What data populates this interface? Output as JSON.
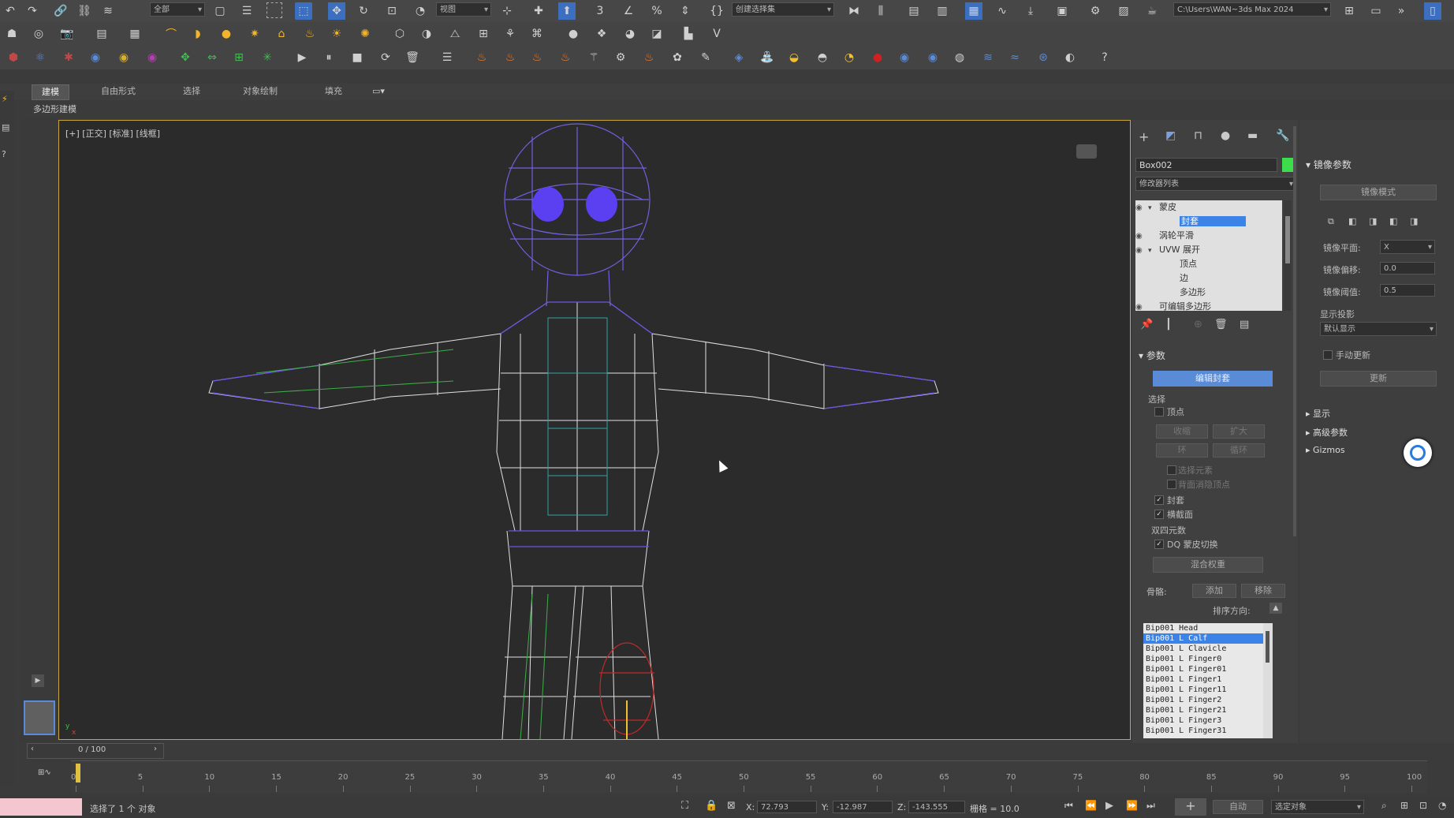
{
  "toolbar": {
    "filter_dropdown": "全部",
    "ref_coord_dropdown": "视图",
    "named_selection_dropdown": "创建选择集",
    "project_path": "C:\\Users\\WAN~3ds Max 2024"
  },
  "ribbon": {
    "tabs": [
      "建模",
      "自由形式",
      "选择",
      "对象绘制",
      "填充"
    ],
    "sub_label": "多边形建模"
  },
  "viewport": {
    "label": "[+] [正交] [标准] [线框]",
    "cursor_icon": "arrow-cursor-icon"
  },
  "command_panel": {
    "object_name": "Box002",
    "object_color": "#3ddc4c",
    "modifier_list_label": "修改器列表",
    "modifier_stack": [
      {
        "label": "蒙皮",
        "indent": 0,
        "selected": false,
        "expanded": true
      },
      {
        "label": "封套",
        "indent": 1,
        "selected": true
      },
      {
        "label": "涡轮平滑",
        "indent": 0,
        "selected": false
      },
      {
        "label": "UVW 展开",
        "indent": 0,
        "selected": false,
        "expanded": true
      },
      {
        "label": "顶点",
        "indent": 1,
        "selected": false
      },
      {
        "label": "边",
        "indent": 1,
        "selected": false
      },
      {
        "label": "多边形",
        "indent": 1,
        "selected": false
      },
      {
        "label": "可编辑多边形",
        "indent": 0,
        "selected": false
      }
    ],
    "params_title": "参数",
    "edit_envelopes_btn": "编辑封套",
    "select_group": "选择",
    "vertices_label": "顶点",
    "shrink_btn": "收缩",
    "grow_btn": "扩大",
    "ring_btn": "环",
    "loop_btn": "循环",
    "select_element_label": "选择元素",
    "backface_cull_label": "背面消隐顶点",
    "envelopes_label": "封套",
    "cross_sections_label": "横截面",
    "dq_group": "双四元数",
    "dq_toggle_label": "DQ 蒙皮切换",
    "blend_weights_btn": "混合权重",
    "bones_label": "骨骼:",
    "add_btn": "添加",
    "remove_btn": "移除",
    "sort_label": "排序方向:",
    "bones": [
      {
        "name": "Bip001 Head",
        "selected": false
      },
      {
        "name": "Bip001 L Calf",
        "selected": true
      },
      {
        "name": "Bip001 L Clavicle",
        "selected": false
      },
      {
        "name": "Bip001 L Finger0",
        "selected": false
      },
      {
        "name": "Bip001 L Finger01",
        "selected": false
      },
      {
        "name": "Bip001 L Finger1",
        "selected": false
      },
      {
        "name": "Bip001 L Finger11",
        "selected": false
      },
      {
        "name": "Bip001 L Finger2",
        "selected": false
      },
      {
        "name": "Bip001 L Finger21",
        "selected": false
      },
      {
        "name": "Bip001 L Finger3",
        "selected": false
      },
      {
        "name": "Bip001 L Finger31",
        "selected": false
      }
    ]
  },
  "mirror_panel": {
    "title": "镜像参数",
    "mirror_mode_btn": "镜像模式",
    "mirror_plane_label": "镜像平面:",
    "mirror_plane_value": "X",
    "mirror_offset_label": "镜像偏移:",
    "mirror_offset_value": "0.0",
    "mirror_threshold_label": "镜像阈值:",
    "mirror_threshold_value": "0.5",
    "display_projection_label": "显示投影",
    "display_projection_value": "默认显示",
    "manual_update_label": "手动更新",
    "update_btn": "更新",
    "collapsed_sections": [
      "显示",
      "高级参数",
      "Gizmos"
    ]
  },
  "timeline": {
    "frame_counter": "0 / 100",
    "ticks": [
      "0",
      "5",
      "10",
      "15",
      "20",
      "25",
      "30",
      "35",
      "40",
      "45",
      "50",
      "55",
      "60",
      "65",
      "70",
      "75",
      "80",
      "85",
      "90",
      "95",
      "100"
    ]
  },
  "status": {
    "message": "选择了 1 个 对象",
    "x_label": "X:",
    "x_value": "72.793",
    "y_label": "Y:",
    "y_value": "-12.987",
    "z_label": "Z:",
    "z_value": "-143.555",
    "grid_label": "栅格 = 10.0",
    "auto_key_btn": "自动",
    "selection_set_dropdown": "选定对象"
  },
  "colors": {
    "accent_blue": "#5a8bd6",
    "viewport_bg": "#2b2b2b",
    "selection_blue": "#3b83e6"
  }
}
